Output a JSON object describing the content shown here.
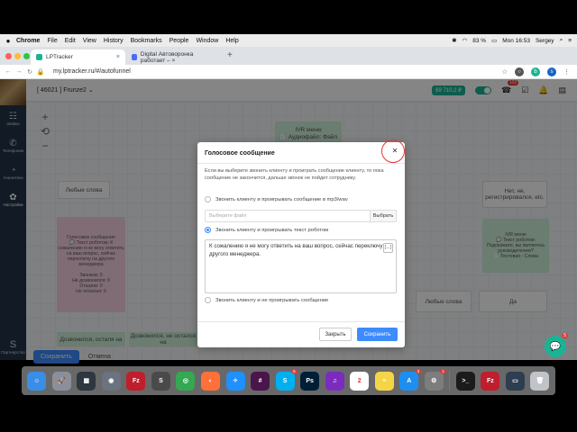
{
  "mac_menubar": {
    "apple": "",
    "app": "Chrome",
    "items": [
      "File",
      "Edit",
      "View",
      "History",
      "Bookmarks",
      "People",
      "Window",
      "Help"
    ],
    "battery": "83 %",
    "clock": "Mon 16:53",
    "user": "Sergey"
  },
  "browser": {
    "tabs": [
      {
        "title": "LPTracker",
        "close": "×",
        "favicon_color": "#1ab394"
      },
      {
        "title": "Digital Автоворонка работает – ×",
        "close": "",
        "favicon_color": "#4a6cf7"
      }
    ],
    "new_tab": "+",
    "url": "my.lptracker.ru/#/autofunnel"
  },
  "left_nav": {
    "items": [
      {
        "label": "Заявки",
        "icon": "☷"
      },
      {
        "label": "Телефония",
        "icon": "✆"
      },
      {
        "label": "Аналитика",
        "icon": "◔"
      },
      {
        "label": "Настройки",
        "icon": "✿"
      }
    ],
    "partner": {
      "label": "Партнерство",
      "icon": "S"
    }
  },
  "header": {
    "account": "[ 46021 ] Frunze2 ⌄",
    "balance": "69 710,2 ₽",
    "notifications_badge": "103"
  },
  "canvas": {
    "nodes": [
      {
        "text": "IVR меню\n📄 Аудиофайл: Файл"
      },
      {
        "text": "Любые слова"
      },
      {
        "text": "Голосовое сообщение\n💬 Текст роботом: К сожалению я не могу ответить на ваш вопрос, сейчас переключу на другого менеджера\n\nЗвонков: 0\nНе дозвонился: 0\nОтказов: 0\nНе оплатил: 0"
      },
      {
        "text": "Нет, не, регистрировался, etc."
      },
      {
        "text": "IVR меню\n💬 Текст роботом: Подскажите, вы являетесь руководителем?\n📄 Тестовая - Слова"
      },
      {
        "text": "Любые слова"
      },
      {
        "text": "Да"
      },
      {
        "text": "Дозвонился, осталя на"
      },
      {
        "text": "Дозвонился, не остался на"
      }
    ],
    "zoom_in": "+",
    "undo": "⟲",
    "zoom_out": "−"
  },
  "bottom_bar": {
    "save": "Сохранить",
    "cancel": "Отмена"
  },
  "chat": {
    "badge": "5"
  },
  "modal": {
    "title": "Голосовое сообщение",
    "close_icon": "✕",
    "description": "Если вы выберите звонить клиенту и проиграть сообщение клиенту, то пока сообщение не закончится, дальше звонок не пойдет сотруднику.",
    "option_mp3": "Звонить клиенту и проигрывать сообщение в mp3/wav",
    "file_placeholder": "Выберите файл",
    "file_button": "Выбрать",
    "option_tts": "Звонить клиенту и проигрывать текст роботом",
    "tts_text": "К сожалению я не могу ответить на ваш вопрос, сейчас переключу на другого менеджера.",
    "option_none": "Звонить клиенту и не проигрывать сообщение",
    "btn_close": "Закрыть",
    "btn_save": "Сохранить"
  },
  "dock": {
    "apps": [
      {
        "name": "Finder",
        "icon": "☺",
        "color": "#3a8ee6"
      },
      {
        "name": "Launchpad",
        "icon": "🚀",
        "color": "#8a8f99"
      },
      {
        "name": "Mission Control",
        "icon": "▦",
        "color": "#2f3640"
      },
      {
        "name": "Disk Utility",
        "icon": "◉",
        "color": "#6b7280"
      },
      {
        "name": "FileZilla",
        "icon": "Fz",
        "color": "#bf1e2d"
      },
      {
        "name": "Sublime Text",
        "icon": "S",
        "color": "#4a4a4a"
      },
      {
        "name": "Chrome",
        "icon": "◎",
        "color": "#34a853"
      },
      {
        "name": "Firefox",
        "icon": "◐",
        "color": "#ff7139"
      },
      {
        "name": "Safari",
        "icon": "✧",
        "color": "#1e90ff"
      },
      {
        "name": "Slack",
        "icon": "#",
        "color": "#4a154b"
      },
      {
        "name": "Skype",
        "icon": "S",
        "color": "#00aff0",
        "badge": "6"
      },
      {
        "name": "Photoshop",
        "icon": "Ps",
        "color": "#001e36"
      },
      {
        "name": "Headphones",
        "icon": "♫",
        "color": "#7b2cbf"
      },
      {
        "name": "Calendar",
        "icon": "2",
        "color": "#ffffff"
      },
      {
        "name": "Notes",
        "icon": "≡",
        "color": "#f5d547"
      },
      {
        "name": "App Store",
        "icon": "A",
        "color": "#1f8ef1",
        "badge": "3"
      },
      {
        "name": "System Preferences",
        "icon": "⚙",
        "color": "#7d7d7d",
        "badge": "1"
      },
      {
        "name": "Terminal",
        "icon": ">_",
        "color": "#1b1b1b"
      },
      {
        "name": "FileZilla Doc",
        "icon": "Fz",
        "color": "#bf1e2d"
      },
      {
        "name": "Screenshot",
        "icon": "▭",
        "color": "#2c3e50"
      },
      {
        "name": "Trash",
        "icon": "🗑",
        "color": "#c0c4c9"
      }
    ]
  }
}
